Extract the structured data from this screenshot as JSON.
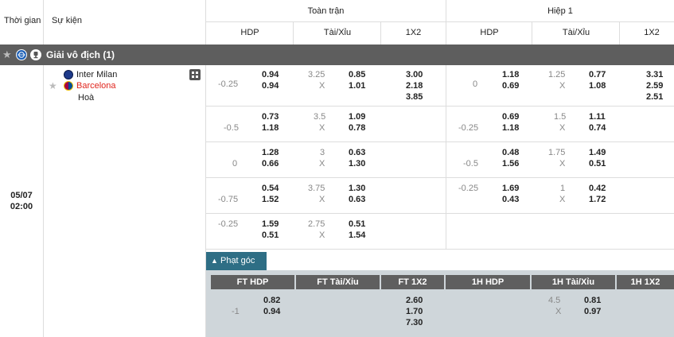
{
  "header": {
    "time_col": "Thời gian",
    "event_col": "Sự kiện",
    "ft_group": "Toàn trận",
    "h1_group": "Hiệp 1",
    "ft_cols": [
      "HDP",
      "Tài/Xỉu",
      "1X2"
    ],
    "h1_cols": [
      "HDP",
      "Tài/Xỉu",
      "1X2"
    ]
  },
  "league": {
    "name": "Giải vô địch (1)"
  },
  "match": {
    "date": "05/07",
    "time": "02:00",
    "home": "Inter Milan",
    "away": "Barcelona",
    "draw": "Hoà"
  },
  "rows": [
    {
      "ft_hdp_line": "-0.25",
      "ft_hdp_home": "0.94",
      "ft_hdp_away": "0.94",
      "ft_ou_line": "3.25",
      "ft_ou_x": "X",
      "ft_ou_over": "0.85",
      "ft_ou_under": "1.01",
      "ft_1x2": [
        "3.00",
        "2.18",
        "3.85"
      ],
      "h1_hdp_line": "0",
      "h1_hdp_home": "1.18",
      "h1_hdp_away": "0.69",
      "h1_ou_line": "1.25",
      "h1_ou_x": "X",
      "h1_ou_over": "0.77",
      "h1_ou_under": "1.08",
      "h1_1x2": [
        "3.31",
        "2.59",
        "2.51"
      ]
    },
    {
      "ft_hdp_line": "-0.5",
      "ft_hdp_home": "0.73",
      "ft_hdp_away": "1.18",
      "ft_ou_line": "3.5",
      "ft_ou_x": "X",
      "ft_ou_over": "1.09",
      "ft_ou_under": "0.78",
      "h1_hdp_line": "-0.25",
      "h1_hdp_home": "0.69",
      "h1_hdp_away": "1.18",
      "h1_ou_line": "1.5",
      "h1_ou_x": "X",
      "h1_ou_over": "1.11",
      "h1_ou_under": "0.74"
    },
    {
      "ft_hdp_line": "0",
      "ft_hdp_home": "1.28",
      "ft_hdp_away": "0.66",
      "ft_ou_line": "3",
      "ft_ou_x": "X",
      "ft_ou_over": "0.63",
      "ft_ou_under": "1.30",
      "h1_hdp_line": "-0.5",
      "h1_hdp_home": "0.48",
      "h1_hdp_away": "1.56",
      "h1_ou_line": "1.75",
      "h1_ou_x": "X",
      "h1_ou_over": "1.49",
      "h1_ou_under": "0.51"
    },
    {
      "ft_hdp_line": "-0.75",
      "ft_hdp_home": "0.54",
      "ft_hdp_away": "1.52",
      "ft_ou_line": "3.75",
      "ft_ou_x": "X",
      "ft_ou_over": "1.30",
      "ft_ou_under": "0.63",
      "h1_hdp_line": "-0.25",
      "h1_hdp_home": "1.69",
      "h1_hdp_away": "0.43",
      "h1_ou_line": "1",
      "h1_ou_x": "X",
      "h1_ou_over": "0.42",
      "h1_ou_under": "1.72"
    },
    {
      "ft_hdp_line": "-0.25",
      "ft_hdp_home": "1.59",
      "ft_hdp_away": "0.51",
      "ft_ou_line": "2.75",
      "ft_ou_x": "X",
      "ft_ou_over": "0.51",
      "ft_ou_under": "1.54"
    }
  ],
  "corners": {
    "tab": "Phạt góc",
    "cols": [
      "FT HDP",
      "FT Tài/Xỉu",
      "FT 1X2",
      "1H HDP",
      "1H Tài/Xỉu",
      "1H 1X2"
    ],
    "ft_hdp_line": "-1",
    "ft_hdp_home": "0.82",
    "ft_hdp_away": "0.94",
    "ft_1x2": [
      "2.60",
      "1.70",
      "7.30"
    ],
    "h1_ou_line": "4.5",
    "h1_ou_x": "X",
    "h1_ou_over": "0.81",
    "h1_ou_under": "0.97"
  },
  "colors": {
    "away_team": "#e0241c",
    "bar": "#5e5e5e",
    "tab": "#2e6e85",
    "corner_bg": "#cfd6da"
  }
}
